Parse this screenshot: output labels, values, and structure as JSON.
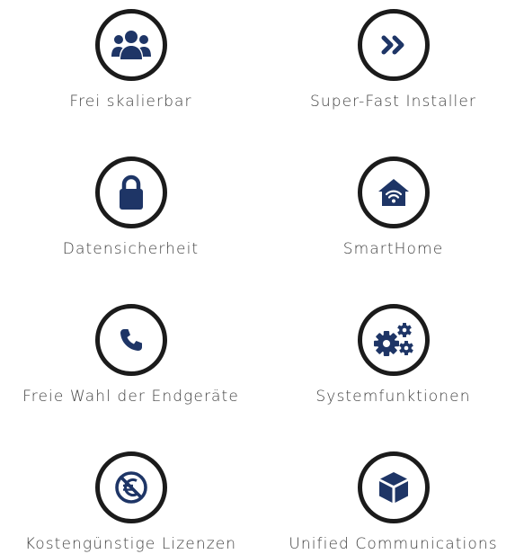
{
  "colors": {
    "icon": "#1e3566",
    "ring": "#1b1b1b",
    "text": "#3f3f3f",
    "background": "#ffffff"
  },
  "features": [
    {
      "label": "Frei skalierbar",
      "icon": "users-icon"
    },
    {
      "label": "Super-Fast Installer",
      "icon": "fast-forward-icon"
    },
    {
      "label": "Datensicherheit",
      "icon": "lock-icon"
    },
    {
      "label": "SmartHome",
      "icon": "smart-home-icon"
    },
    {
      "label": "Freie Wahl der Endgeräte",
      "icon": "phone-icon"
    },
    {
      "label": "Systemfunktionen",
      "icon": "gears-icon"
    },
    {
      "label": "Kostengünstige Lizenzen",
      "icon": "no-euro-icon"
    },
    {
      "label": "Unified Communications",
      "icon": "cube-icon"
    }
  ]
}
